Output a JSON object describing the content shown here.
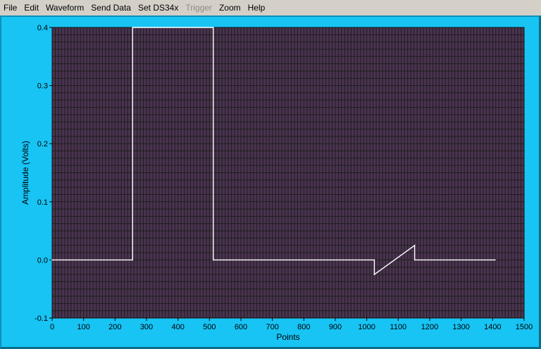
{
  "menu": {
    "items": [
      {
        "label": "File",
        "enabled": true
      },
      {
        "label": "Edit",
        "enabled": true
      },
      {
        "label": "Waveform",
        "enabled": true
      },
      {
        "label": "Send Data",
        "enabled": true
      },
      {
        "label": "Set DS34x",
        "enabled": true
      },
      {
        "label": "Trigger",
        "enabled": false
      },
      {
        "label": "Zoom",
        "enabled": true
      },
      {
        "label": "Help",
        "enabled": true
      }
    ]
  },
  "colors": {
    "panel": "#17c4f4",
    "plot_background": "#4a3350",
    "grid": "#1e1e1e",
    "trace": "#ffffff"
  },
  "chart_data": {
    "type": "line",
    "xlabel": "Points",
    "ylabel": "Amplitude (Volts)",
    "xlim": [
      0,
      1500
    ],
    "ylim": [
      -0.1,
      0.4
    ],
    "x_ticks": [
      0,
      100,
      200,
      300,
      400,
      500,
      600,
      700,
      800,
      900,
      1000,
      1100,
      1200,
      1300,
      1400,
      1500
    ],
    "y_ticks": [
      -0.1,
      0.0,
      0.1,
      0.2,
      0.3,
      0.4
    ],
    "y_tick_labels": [
      "-0.1",
      "0.0",
      "0.1",
      "0.2",
      "0.3",
      "0.4"
    ],
    "grid": true,
    "minor_divisions": {
      "x": 10,
      "y": 8
    },
    "series": [
      {
        "x": [
          0,
          256,
          256,
          512,
          512,
          1024,
          1024,
          1152,
          1152,
          1408
        ],
        "y": [
          0.0,
          0.0,
          0.4,
          0.4,
          0.0,
          0.0,
          -0.025,
          0.025,
          0.0,
          0.0
        ]
      }
    ]
  }
}
